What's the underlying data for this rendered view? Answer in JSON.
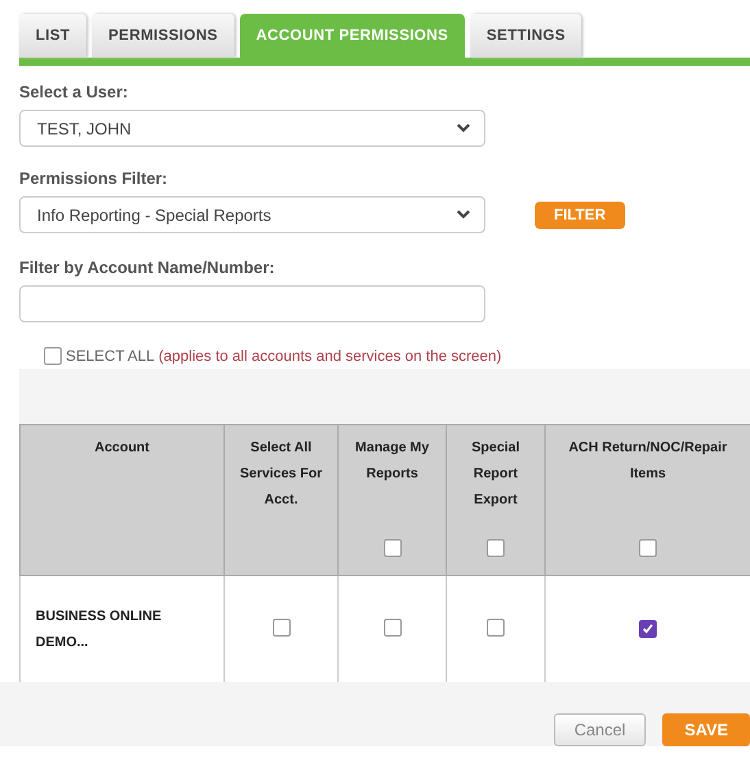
{
  "tabs": [
    {
      "label": "LIST",
      "selected": false
    },
    {
      "label": "PERMISSIONS",
      "selected": false
    },
    {
      "label": "ACCOUNT PERMISSIONS",
      "selected": true
    },
    {
      "label": "SETTINGS",
      "selected": false
    }
  ],
  "user_select": {
    "label": "Select a User:",
    "value": "TEST, JOHN"
  },
  "permissions_filter": {
    "label": "Permissions Filter:",
    "value": "Info Reporting - Special Reports",
    "button": "FILTER"
  },
  "account_filter": {
    "label": "Filter by Account Name/Number:"
  },
  "select_all": {
    "label": "SELECT ALL",
    "note": "(applies to all accounts and services on the screen)",
    "checked": false
  },
  "table": {
    "columns": [
      {
        "label": "Account"
      },
      {
        "label": "Select All Services For Acct."
      },
      {
        "label": "Manage My Reports",
        "checked": false
      },
      {
        "label": "Special Report Export",
        "checked": false
      },
      {
        "label": "ACH Return/NOC/Repair Items",
        "checked": false
      }
    ],
    "rows": [
      {
        "account": "BUSINESS ONLINE DEMO...",
        "checks": [
          false,
          false,
          false,
          true
        ]
      }
    ]
  },
  "buttons": {
    "cancel": "Cancel",
    "save": "SAVE"
  }
}
